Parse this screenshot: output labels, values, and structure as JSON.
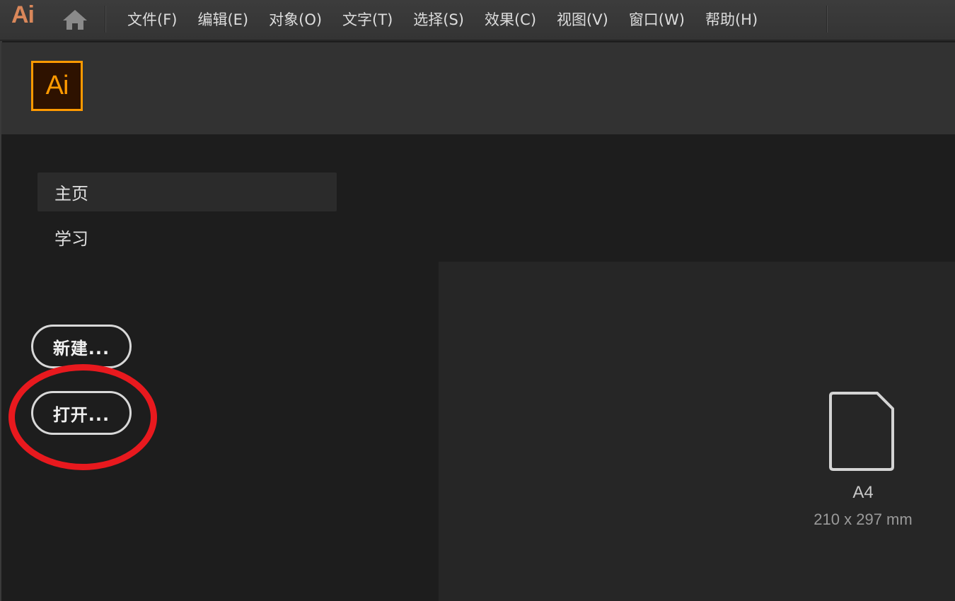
{
  "menubar": {
    "app_logo": "Ai",
    "items": [
      {
        "label": "文件(F)"
      },
      {
        "label": "编辑(E)"
      },
      {
        "label": "对象(O)"
      },
      {
        "label": "文字(T)"
      },
      {
        "label": "选择(S)"
      },
      {
        "label": "效果(C)"
      },
      {
        "label": "视图(V)"
      },
      {
        "label": "窗口(W)"
      },
      {
        "label": "帮助(H)"
      }
    ]
  },
  "header": {
    "badge_text": "Ai",
    "badge_color": "#ff9a00"
  },
  "sidebar": {
    "nav": [
      {
        "label": "主页",
        "active": true
      },
      {
        "label": "学习",
        "active": false
      }
    ],
    "new_button": "新建...",
    "open_button": "打开..."
  },
  "annotation": {
    "ring_color": "#e8191e"
  },
  "presets": [
    {
      "name": "A4",
      "size": "210 x 297 mm",
      "icon": "document-icon"
    }
  ]
}
